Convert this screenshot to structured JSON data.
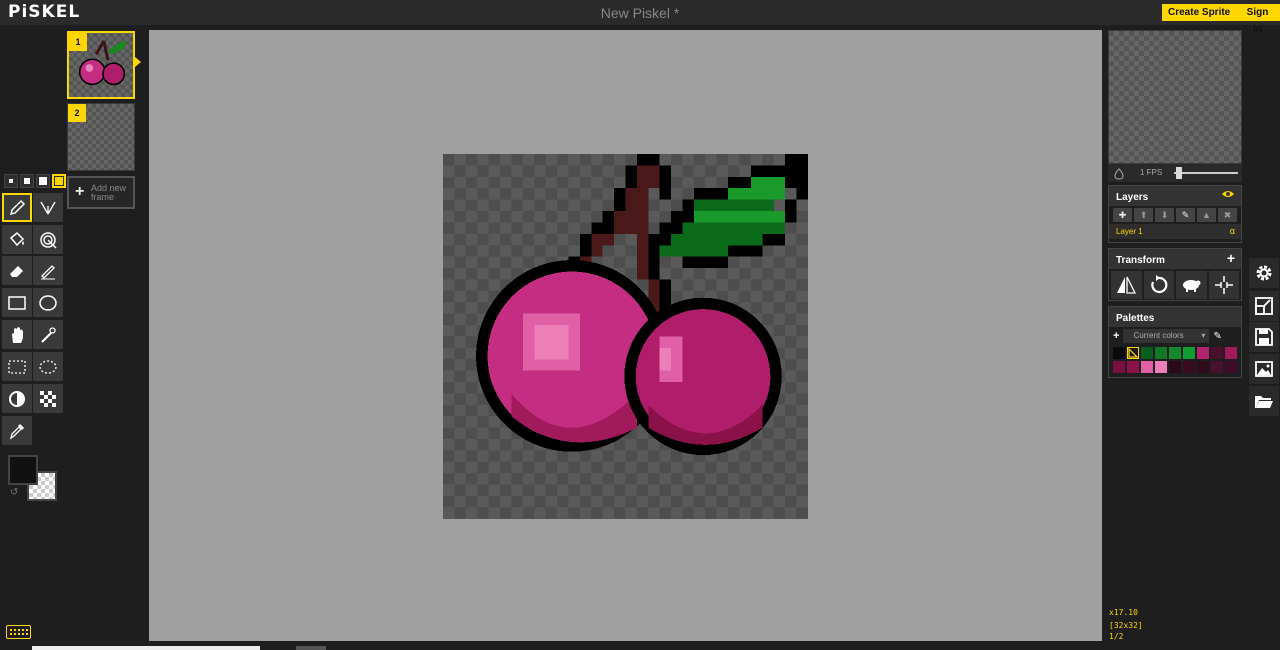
{
  "app": {
    "logo": "PiSKEL",
    "title": "New Piskel *"
  },
  "header": {
    "create_sprite": "Create Sprite",
    "sign_in": "Sign in"
  },
  "tools": [
    {
      "name": "pen-tool",
      "icon": "pen-icon"
    },
    {
      "name": "vertical-mirror-pen-tool",
      "icon": "mirror-pen-icon"
    },
    {
      "name": "paint-bucket-tool",
      "icon": "bucket-icon"
    },
    {
      "name": "paint-all-same-color-tool",
      "icon": "spiral-icon"
    },
    {
      "name": "eraser-tool",
      "icon": "eraser-icon"
    },
    {
      "name": "stroke-tool",
      "icon": "stroke-icon"
    },
    {
      "name": "rectangle-tool",
      "icon": "rectangle-icon"
    },
    {
      "name": "circle-tool",
      "icon": "circle-icon"
    },
    {
      "name": "move-tool",
      "icon": "hand-icon"
    },
    {
      "name": "shape-selection-tool",
      "icon": "magic-wand-icon"
    },
    {
      "name": "rectangle-selection-tool",
      "icon": "rect-select-icon"
    },
    {
      "name": "lasso-selection-tool",
      "icon": "lasso-icon"
    },
    {
      "name": "lighten-tool",
      "icon": "lighten-icon"
    },
    {
      "name": "dithering-tool",
      "icon": "checker-icon"
    },
    {
      "name": "color-picker-tool",
      "icon": "eyedropper-icon"
    }
  ],
  "colors": {
    "primary": "#111111",
    "secondary": "transparent",
    "accent": "#ffd700"
  },
  "frames": [
    {
      "number": "1"
    },
    {
      "number": "2"
    }
  ],
  "add_frame": "Add new frame",
  "preview": {
    "fps_label": "1 FPS",
    "fps": 1
  },
  "layers": {
    "title": "Layers",
    "items": [
      {
        "name": "Layer 1",
        "alpha": "α"
      }
    ]
  },
  "transform": {
    "title": "Transform"
  },
  "palettes": {
    "title": "Palettes",
    "selected": "Current colors",
    "swatches": [
      "#0a0a0a",
      "#1a1a1a",
      "#0b5d1e",
      "#0f7a26",
      "#14882c",
      "#139b33",
      "#b3246f",
      "#4a0f2a",
      "#a01a5c",
      "#7a1040",
      "#8a1248",
      "#e05fa5",
      "#ec7fb7",
      "#2a0a18",
      "#3a0a1e",
      "#2e0c1c",
      "#4a1030",
      "#3e0c26"
    ]
  },
  "status": {
    "zoom": "x17.10",
    "size": "[32x32]",
    "frame": "1/2"
  }
}
